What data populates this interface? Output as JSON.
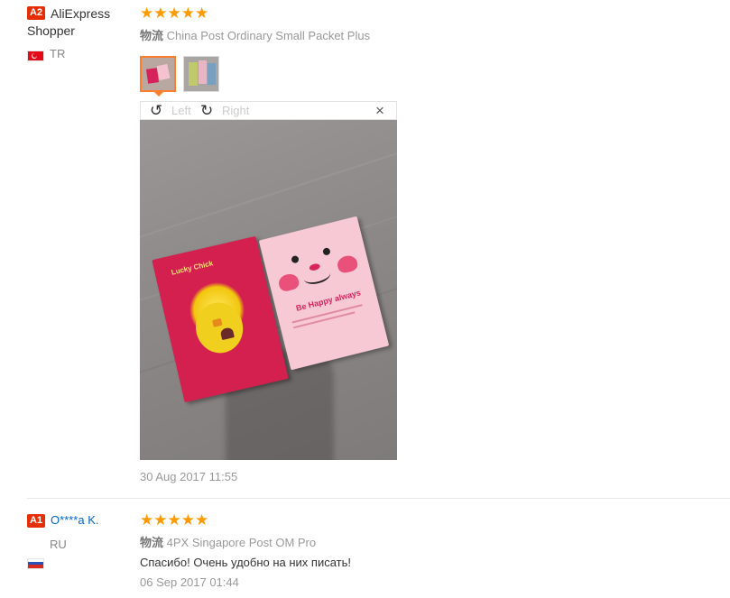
{
  "reviews": [
    {
      "badge": "A2",
      "name": "AliExpress Shopper",
      "country": "TR",
      "rating": 5,
      "stars": "★★★★★",
      "shipping_label": "物流",
      "shipping_method": "China Post Ordinary Small Packet Plus",
      "date": "30 Aug 2017 11:55",
      "viewer": {
        "rotate_left_label": "Left",
        "rotate_right_label": "Right",
        "close_glyph": "×",
        "photo": {
          "left_card_text": "Lucky Chick",
          "right_card_text": "Be Happy always"
        }
      }
    },
    {
      "badge": "A1",
      "name": "O****a K.",
      "country": "RU",
      "rating": 5,
      "stars": "★★★★★",
      "shipping_label": "物流",
      "shipping_method": "4PX Singapore Post OM Pro",
      "comment": "Спасибо! Очень удобно на них писать!",
      "date": "06 Sep 2017 01:44"
    }
  ],
  "colors": {
    "badge": "#e62e04",
    "star": "#ff9a00",
    "name_link": "#0066cc",
    "active_thumb_border": "#ff7e2c"
  }
}
